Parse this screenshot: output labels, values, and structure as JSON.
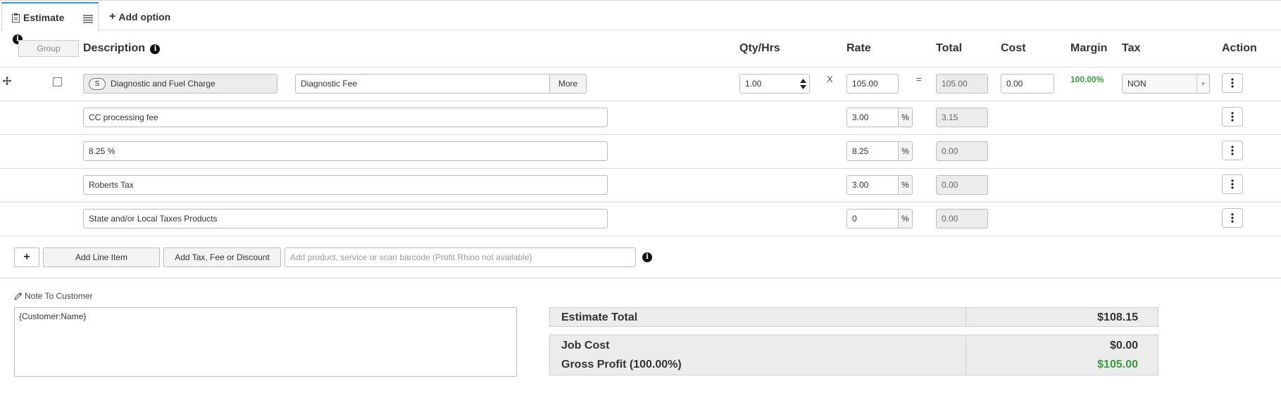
{
  "tabs": {
    "active_label": "Estimate",
    "add_option_label": "Add option"
  },
  "header": {
    "group_label": "Group",
    "description": "Description",
    "qty_hrs": "Qty/Hrs",
    "rate": "Rate",
    "total": "Total",
    "cost": "Cost",
    "margin": "Margin",
    "tax": "Tax",
    "action": "Action"
  },
  "main_item": {
    "badge": "S",
    "name": "Diagnostic and Fuel Charge",
    "description": "Diagnostic Fee",
    "more_label": "More",
    "qty": "1.00",
    "multiply_sign": "X",
    "rate": "105.00",
    "equals_sign": "=",
    "total": "105.00",
    "cost": "0.00",
    "margin": "100.00%",
    "tax_selected": "NON"
  },
  "fee_rows": [
    {
      "description": "CC processing fee",
      "rate": "3.00",
      "unit": "%",
      "total": "3.15"
    },
    {
      "description": "8.25 %",
      "rate": "8.25",
      "unit": "%",
      "total": "0.00"
    },
    {
      "description": "Roberts Tax",
      "rate": "3.00",
      "unit": "%",
      "total": "0.00"
    },
    {
      "description": "State and/or Local Taxes Products",
      "rate": "0",
      "unit": "%",
      "total": "0.00"
    }
  ],
  "toolbar": {
    "plus_label": "+",
    "add_line_item_label": "Add Line Item",
    "add_tax_label": "Add Tax, Fee or Discount",
    "search_placeholder": "Add product, service or scan barcode (Profit Rhino not available)"
  },
  "note": {
    "label": "Note To Customer",
    "value": "{Customer:Name}"
  },
  "summary": {
    "estimate_total_label": "Estimate Total",
    "estimate_total_value": "$108.15",
    "job_cost_label": "Job Cost",
    "job_cost_value": "$0.00",
    "gross_profit_label": "Gross Profit (100.00%)",
    "gross_profit_value": "$105.00"
  },
  "colors": {
    "accent": "#28a0d9",
    "positive": "#3b9a3b"
  }
}
